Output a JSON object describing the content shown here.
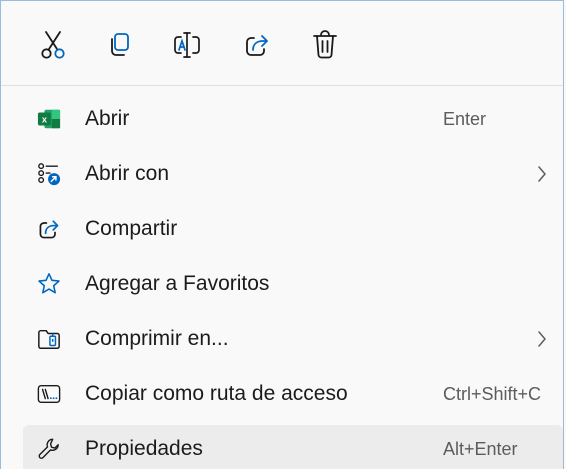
{
  "toolbar": {
    "buttons": [
      {
        "name": "cut",
        "icon": "scissors-icon"
      },
      {
        "name": "copy",
        "icon": "copy-icon"
      },
      {
        "name": "rename",
        "icon": "rename-icon"
      },
      {
        "name": "share",
        "icon": "share-icon"
      },
      {
        "name": "delete",
        "icon": "trash-icon"
      }
    ]
  },
  "menu": {
    "items": [
      {
        "label": "Abrir",
        "shortcut": "Enter",
        "icon": "excel-icon"
      },
      {
        "label": "Abrir con",
        "shortcut": "",
        "icon": "open-with-icon",
        "submenu": true
      },
      {
        "label": "Compartir",
        "shortcut": "",
        "icon": "share-icon"
      },
      {
        "label": "Agregar a Favoritos",
        "shortcut": "",
        "icon": "star-icon"
      },
      {
        "label": "Comprimir en...",
        "shortcut": "",
        "icon": "zip-folder-icon",
        "submenu": true
      },
      {
        "label": "Copiar como ruta de acceso",
        "shortcut": "Ctrl+Shift+C",
        "icon": "path-icon"
      },
      {
        "label": "Propiedades",
        "shortcut": "Alt+Enter",
        "icon": "wrench-icon",
        "hovered": true
      }
    ]
  },
  "colors": {
    "accent": "#0067c0",
    "excel_green": "#107c41",
    "hover_bg": "#ececec",
    "border": "#9bbcd8"
  }
}
